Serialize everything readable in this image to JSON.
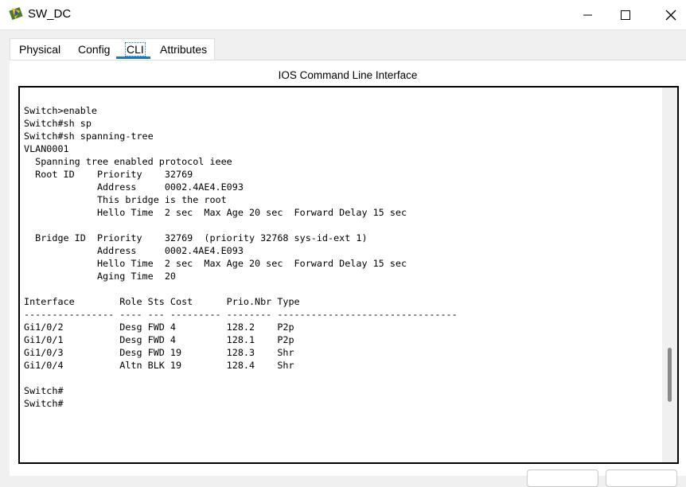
{
  "window": {
    "title": "SW_DC",
    "icon": "packet-tracer-switch-icon"
  },
  "tabs": [
    {
      "label": "Physical"
    },
    {
      "label": "Config"
    },
    {
      "label": "CLI",
      "active": true
    },
    {
      "label": "Attributes"
    }
  ],
  "panel": {
    "title": "IOS Command Line Interface"
  },
  "terminal": {
    "lines": [
      "Switch>enable",
      "Switch#sh sp",
      "Switch#sh spanning-tree",
      "VLAN0001",
      "  Spanning tree enabled protocol ieee",
      "  Root ID    Priority    32769",
      "             Address     0002.4AE4.E093",
      "             This bridge is the root",
      "             Hello Time  2 sec  Max Age 20 sec  Forward Delay 15 sec",
      "",
      "  Bridge ID  Priority    32769  (priority 32768 sys-id-ext 1)",
      "             Address     0002.4AE4.E093",
      "             Hello Time  2 sec  Max Age 20 sec  Forward Delay 15 sec",
      "             Aging Time  20",
      "",
      "Interface        Role Sts Cost      Prio.Nbr Type",
      "---------------- ---- --- --------- -------- --------------------------------",
      "Gi1/0/2          Desg FWD 4         128.2    P2p",
      "Gi1/0/1          Desg FWD 4         128.1    P2p",
      "Gi1/0/3          Desg FWD 19        128.3    Shr",
      "Gi1/0/4          Altn BLK 19        128.4    Shr",
      "",
      "Switch#",
      "Switch#"
    ]
  },
  "colors": {
    "accent": "#1a78c2",
    "background": "#f0f0f0"
  }
}
